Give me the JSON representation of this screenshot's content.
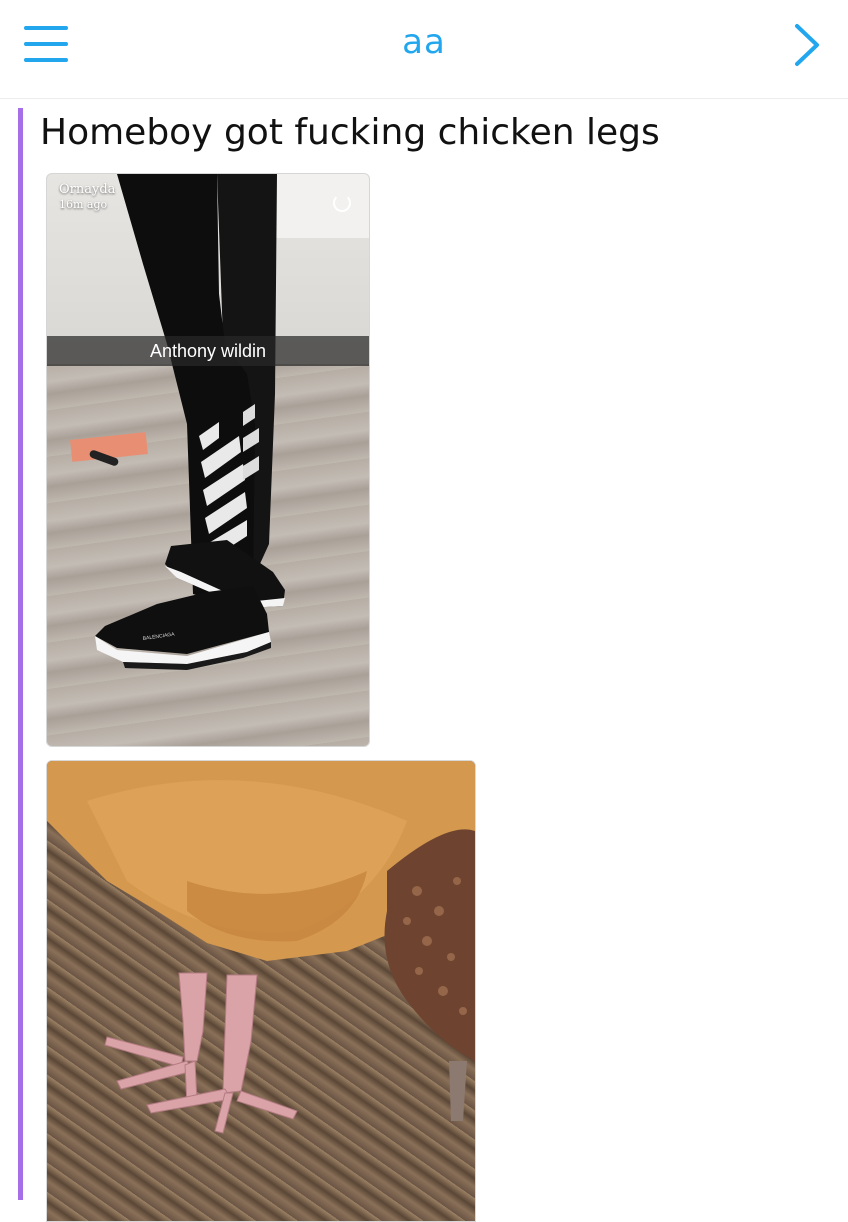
{
  "header": {
    "title": "aa",
    "menu_icon": "hamburger-menu-icon",
    "forward_icon": "chevron-right-icon",
    "accent_color": "#22a6ee"
  },
  "message": {
    "sender_color": "#a66ee8",
    "text": "Homeboy got fucking chicken legs"
  },
  "snap": {
    "author": "Ornayda",
    "time": "16m ago",
    "caption": "Anthony wildin",
    "brand_on_shoe": "BALENCIAGA",
    "timer_icon": "snap-timer-icon"
  },
  "photo2": {
    "subject": "chicken-legs-photo"
  }
}
